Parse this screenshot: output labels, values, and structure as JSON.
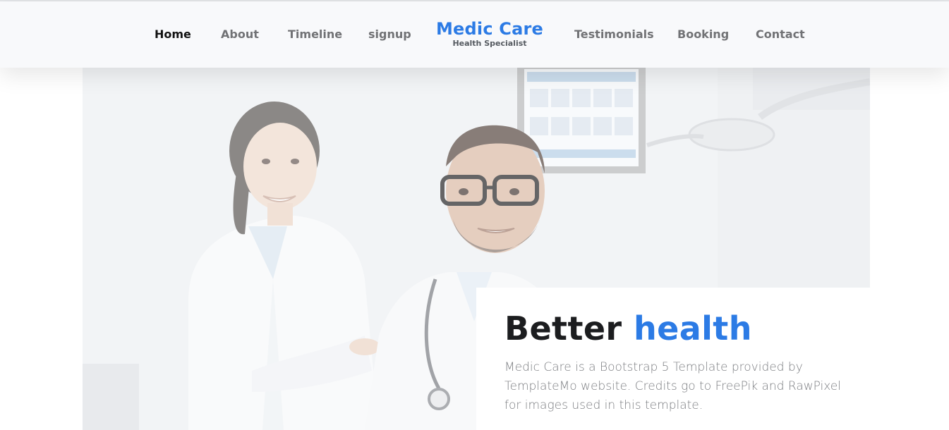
{
  "nav": {
    "left_items": [
      {
        "label": "Home",
        "active": true
      },
      {
        "label": "About",
        "active": false
      },
      {
        "label": "Timeline",
        "active": false
      },
      {
        "label": "signup",
        "active": false
      }
    ],
    "right_items": [
      {
        "label": "Testimonials",
        "active": false
      },
      {
        "label": "Booking",
        "active": false
      },
      {
        "label": "Contact",
        "active": false
      }
    ]
  },
  "brand": {
    "title": "Medic Care",
    "subtitle": "Health Specialist"
  },
  "hero": {
    "heading_part1": "Better",
    "heading_part2": "health",
    "description_lines": [
      "Medic Care is a Bootstrap 5 Template provided by",
      "TemplateMo website. Credits go to FreePik and RawPixel",
      "for images used in this template."
    ]
  },
  "colors": {
    "accent": "#2c7be5",
    "nav_background": "#f8f9fb",
    "heading": "#1c1d1f",
    "body_text": "#7b7d81"
  }
}
